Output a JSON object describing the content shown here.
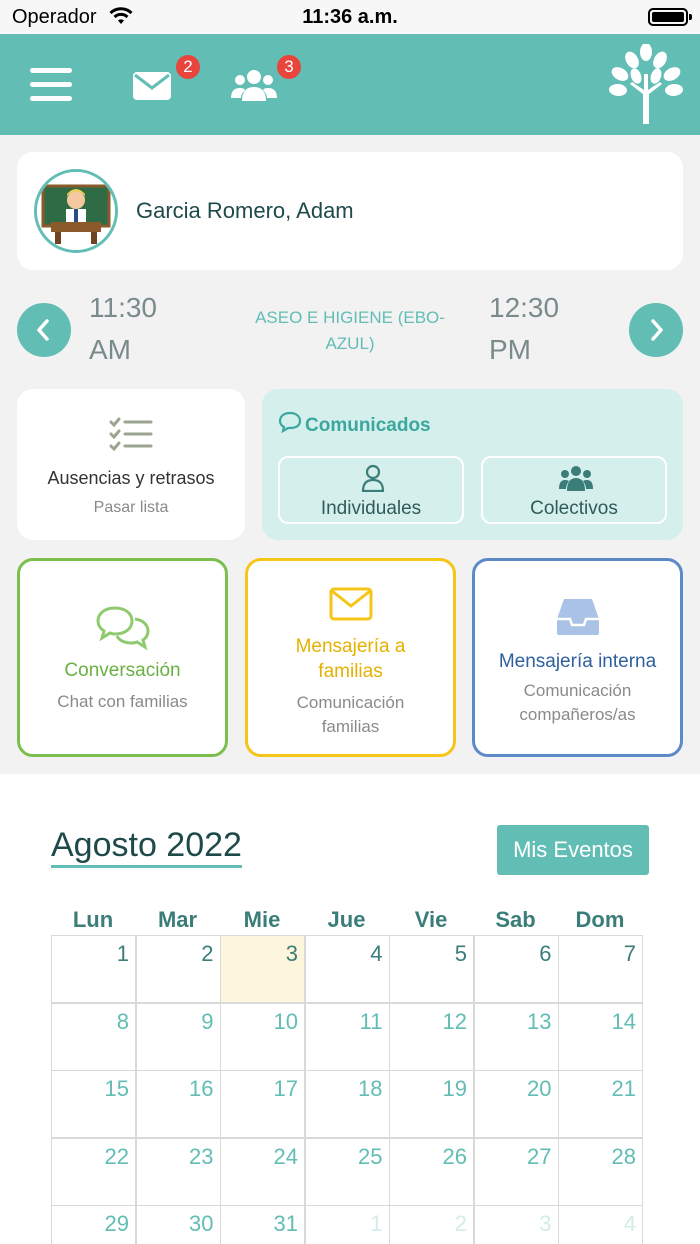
{
  "status_bar": {
    "carrier": "Operador",
    "time": "11:36 a.m."
  },
  "header": {
    "messages_badge": "2",
    "groups_badge": "3"
  },
  "profile": {
    "name": "Garcia Romero, Adam"
  },
  "schedule": {
    "start_time": "11:30",
    "start_period": "AM",
    "subject_line1": "ASEO E HIGIENE (EBO-",
    "subject_line2": "AZUL)",
    "end_time": "12:30",
    "end_period": "PM"
  },
  "cards": {
    "absences": {
      "title": "Ausencias y retrasos",
      "subtitle": "Pasar lista"
    },
    "communications": {
      "title": "Comunicados",
      "individual_label": "Individuales",
      "collective_label": "Colectivos"
    }
  },
  "tiles": {
    "conversation": {
      "title": "Conversación",
      "subtitle": "Chat con familias",
      "color": "#7cbf4f"
    },
    "family_messaging": {
      "title_line1": "Mensajería a",
      "title_line2": "familias",
      "subtitle_line1": "Comunicación",
      "subtitle_line2": "familias",
      "color": "#f5c518"
    },
    "internal_messaging": {
      "title": "Mensajería interna",
      "subtitle_line1": "Comunicación",
      "subtitle_line2": "compañeros/as",
      "color": "#5b8ac6"
    }
  },
  "calendar": {
    "title": "Agosto 2022",
    "events_button": "Mis Eventos",
    "weekdays": [
      "Lun",
      "Mar",
      "Mie",
      "Jue",
      "Vie",
      "Sab",
      "Dom"
    ],
    "weeks": [
      [
        "1",
        "2",
        "3",
        "4",
        "5",
        "6",
        "7"
      ],
      [
        "8",
        "9",
        "10",
        "11",
        "12",
        "13",
        "14"
      ],
      [
        "15",
        "16",
        "17",
        "18",
        "19",
        "20",
        "21"
      ],
      [
        "22",
        "23",
        "24",
        "25",
        "26",
        "27",
        "28"
      ],
      [
        "29",
        "30",
        "31",
        "1",
        "2",
        "3",
        "4"
      ]
    ],
    "today": "3"
  }
}
